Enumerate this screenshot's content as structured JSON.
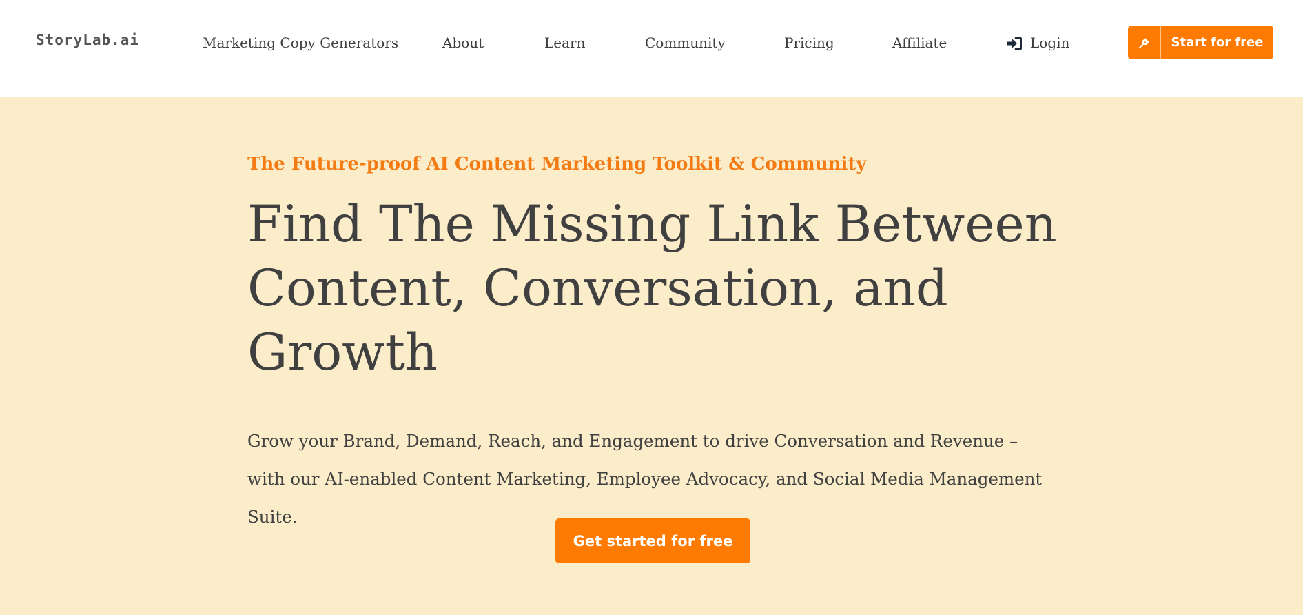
{
  "header": {
    "logo_text": "StoryLab.ai",
    "nav": {
      "marketing_copy_generators": "Marketing Copy Generators",
      "about": "About",
      "learn": "Learn",
      "community": "Community",
      "pricing": "Pricing",
      "affiliate": "Affiliate",
      "login": "Login"
    },
    "login_icon": "sign-in-icon",
    "cta": {
      "icon": "pen-nib-icon",
      "label": "Start for free"
    }
  },
  "hero": {
    "eyebrow": "The Future-proof AI Content Marketing Toolkit & Community",
    "headline": "Find The Missing Link Between Content, Conversation, and Growth",
    "subtext": "Grow your Brand, Demand, Reach, and Engagement to drive Conversation and Revenue – with our AI-enabled Content Marketing, Employee Advocacy, and Social Media Management Suite.",
    "cta_label": "Get started for free"
  },
  "colors": {
    "accent": "#ff7a00",
    "eyebrow": "#f47b13",
    "hero_background": "#fbecca",
    "text": "#404040"
  }
}
